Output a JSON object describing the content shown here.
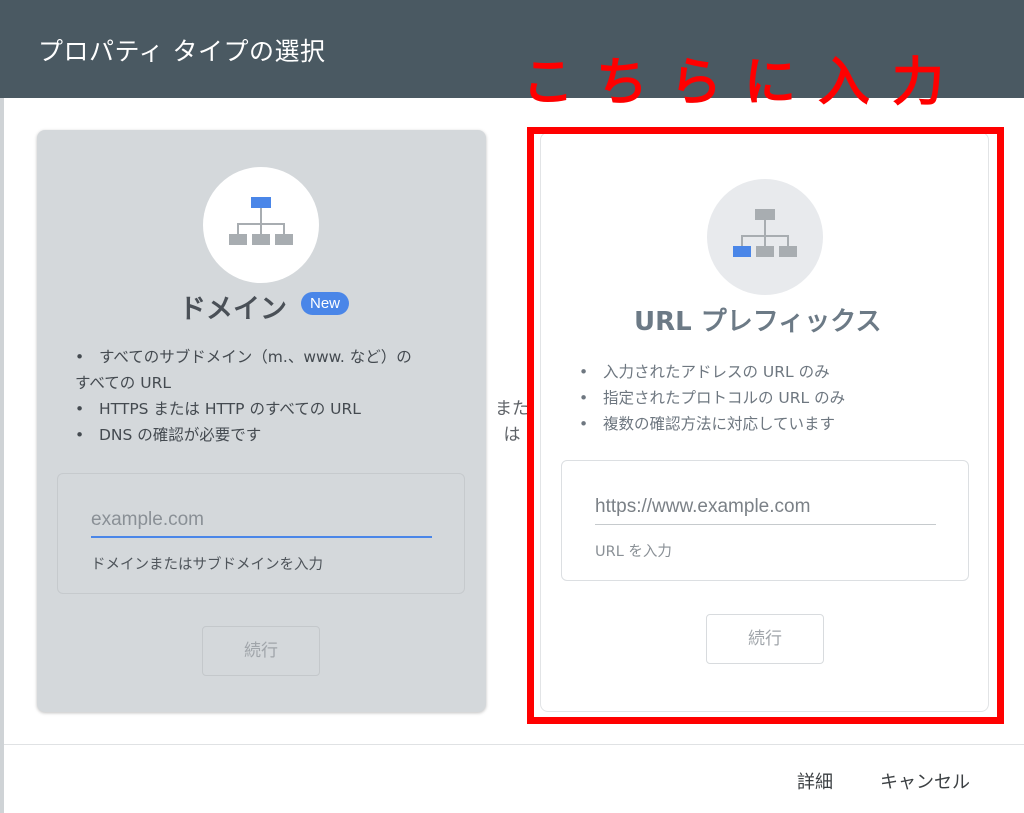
{
  "header": {
    "title": "プロパティ タイプの選択"
  },
  "annotation": {
    "text": "こちらに入力"
  },
  "domain_card": {
    "title": "ドメイン",
    "badge": "New",
    "icon": "sitemap-icon",
    "bullets": [
      "すべてのサブドメイン（m.、www. など）の",
      "すべての URL",
      "HTTPS または HTTP のすべての URL",
      "DNS の確認が必要です"
    ],
    "input_placeholder": "example.com",
    "input_helper": "ドメインまたはサブドメインを入力",
    "continue_label": "続行"
  },
  "or_label": {
    "line1": "また",
    "line2": "は"
  },
  "url_card": {
    "title": "URL プレフィックス",
    "icon": "sitemap-icon",
    "bullets": [
      "入力されたアドレスの URL のみ",
      "指定されたプロトコルの URL のみ",
      "複数の確認方法に対応しています"
    ],
    "input_placeholder": "https://www.example.com",
    "input_helper": "URL を入力",
    "continue_label": "続行"
  },
  "footer": {
    "details_label": "詳細",
    "cancel_label": "キャンセル"
  },
  "colors": {
    "header_bg": "#4a5962",
    "accent_blue": "#4a86e8",
    "annotation_red": "#ff0000",
    "domain_card_bg": "#d4d8db"
  }
}
